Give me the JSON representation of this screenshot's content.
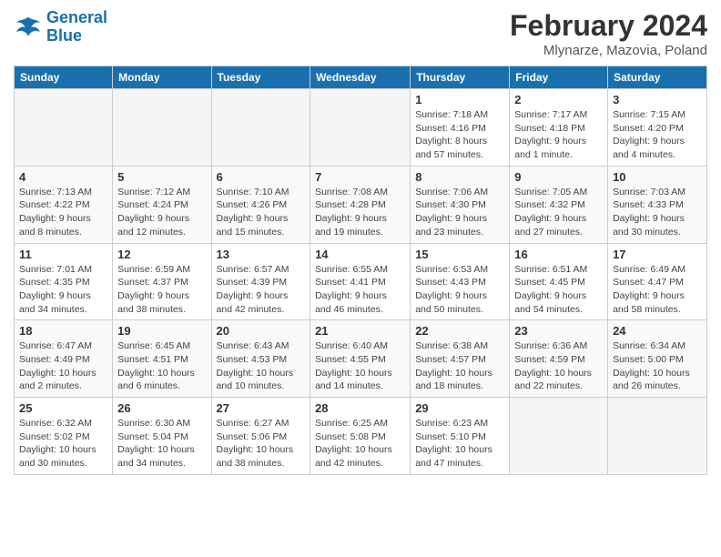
{
  "logo": {
    "line1": "General",
    "line2": "Blue"
  },
  "title": "February 2024",
  "location": "Mlynarze, Mazovia, Poland",
  "weekdays": [
    "Sunday",
    "Monday",
    "Tuesday",
    "Wednesday",
    "Thursday",
    "Friday",
    "Saturday"
  ],
  "weeks": [
    [
      {
        "day": "",
        "info": ""
      },
      {
        "day": "",
        "info": ""
      },
      {
        "day": "",
        "info": ""
      },
      {
        "day": "",
        "info": ""
      },
      {
        "day": "1",
        "info": "Sunrise: 7:18 AM\nSunset: 4:16 PM\nDaylight: 8 hours\nand 57 minutes."
      },
      {
        "day": "2",
        "info": "Sunrise: 7:17 AM\nSunset: 4:18 PM\nDaylight: 9 hours\nand 1 minute."
      },
      {
        "day": "3",
        "info": "Sunrise: 7:15 AM\nSunset: 4:20 PM\nDaylight: 9 hours\nand 4 minutes."
      }
    ],
    [
      {
        "day": "4",
        "info": "Sunrise: 7:13 AM\nSunset: 4:22 PM\nDaylight: 9 hours\nand 8 minutes."
      },
      {
        "day": "5",
        "info": "Sunrise: 7:12 AM\nSunset: 4:24 PM\nDaylight: 9 hours\nand 12 minutes."
      },
      {
        "day": "6",
        "info": "Sunrise: 7:10 AM\nSunset: 4:26 PM\nDaylight: 9 hours\nand 15 minutes."
      },
      {
        "day": "7",
        "info": "Sunrise: 7:08 AM\nSunset: 4:28 PM\nDaylight: 9 hours\nand 19 minutes."
      },
      {
        "day": "8",
        "info": "Sunrise: 7:06 AM\nSunset: 4:30 PM\nDaylight: 9 hours\nand 23 minutes."
      },
      {
        "day": "9",
        "info": "Sunrise: 7:05 AM\nSunset: 4:32 PM\nDaylight: 9 hours\nand 27 minutes."
      },
      {
        "day": "10",
        "info": "Sunrise: 7:03 AM\nSunset: 4:33 PM\nDaylight: 9 hours\nand 30 minutes."
      }
    ],
    [
      {
        "day": "11",
        "info": "Sunrise: 7:01 AM\nSunset: 4:35 PM\nDaylight: 9 hours\nand 34 minutes."
      },
      {
        "day": "12",
        "info": "Sunrise: 6:59 AM\nSunset: 4:37 PM\nDaylight: 9 hours\nand 38 minutes."
      },
      {
        "day": "13",
        "info": "Sunrise: 6:57 AM\nSunset: 4:39 PM\nDaylight: 9 hours\nand 42 minutes."
      },
      {
        "day": "14",
        "info": "Sunrise: 6:55 AM\nSunset: 4:41 PM\nDaylight: 9 hours\nand 46 minutes."
      },
      {
        "day": "15",
        "info": "Sunrise: 6:53 AM\nSunset: 4:43 PM\nDaylight: 9 hours\nand 50 minutes."
      },
      {
        "day": "16",
        "info": "Sunrise: 6:51 AM\nSunset: 4:45 PM\nDaylight: 9 hours\nand 54 minutes."
      },
      {
        "day": "17",
        "info": "Sunrise: 6:49 AM\nSunset: 4:47 PM\nDaylight: 9 hours\nand 58 minutes."
      }
    ],
    [
      {
        "day": "18",
        "info": "Sunrise: 6:47 AM\nSunset: 4:49 PM\nDaylight: 10 hours\nand 2 minutes."
      },
      {
        "day": "19",
        "info": "Sunrise: 6:45 AM\nSunset: 4:51 PM\nDaylight: 10 hours\nand 6 minutes."
      },
      {
        "day": "20",
        "info": "Sunrise: 6:43 AM\nSunset: 4:53 PM\nDaylight: 10 hours\nand 10 minutes."
      },
      {
        "day": "21",
        "info": "Sunrise: 6:40 AM\nSunset: 4:55 PM\nDaylight: 10 hours\nand 14 minutes."
      },
      {
        "day": "22",
        "info": "Sunrise: 6:38 AM\nSunset: 4:57 PM\nDaylight: 10 hours\nand 18 minutes."
      },
      {
        "day": "23",
        "info": "Sunrise: 6:36 AM\nSunset: 4:59 PM\nDaylight: 10 hours\nand 22 minutes."
      },
      {
        "day": "24",
        "info": "Sunrise: 6:34 AM\nSunset: 5:00 PM\nDaylight: 10 hours\nand 26 minutes."
      }
    ],
    [
      {
        "day": "25",
        "info": "Sunrise: 6:32 AM\nSunset: 5:02 PM\nDaylight: 10 hours\nand 30 minutes."
      },
      {
        "day": "26",
        "info": "Sunrise: 6:30 AM\nSunset: 5:04 PM\nDaylight: 10 hours\nand 34 minutes."
      },
      {
        "day": "27",
        "info": "Sunrise: 6:27 AM\nSunset: 5:06 PM\nDaylight: 10 hours\nand 38 minutes."
      },
      {
        "day": "28",
        "info": "Sunrise: 6:25 AM\nSunset: 5:08 PM\nDaylight: 10 hours\nand 42 minutes."
      },
      {
        "day": "29",
        "info": "Sunrise: 6:23 AM\nSunset: 5:10 PM\nDaylight: 10 hours\nand 47 minutes."
      },
      {
        "day": "",
        "info": ""
      },
      {
        "day": "",
        "info": ""
      }
    ]
  ]
}
